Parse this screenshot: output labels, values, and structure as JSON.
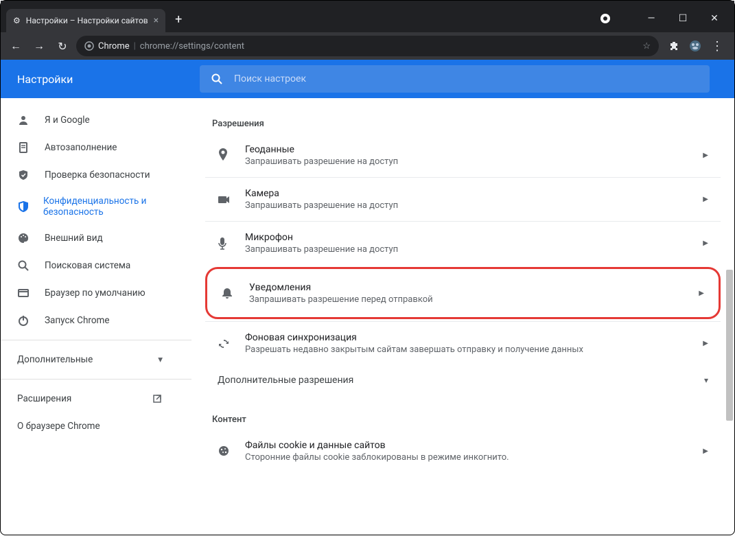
{
  "window": {
    "tab_title": "Настройки – Настройки сайтов",
    "new_tab": "+",
    "minimize": "—",
    "maximize": "☐",
    "close": "✕"
  },
  "toolbar": {
    "back": "←",
    "forward": "→",
    "reload": "↻",
    "chrome_label": "Chrome",
    "url": "chrome://settings/content",
    "star": "☆"
  },
  "header": {
    "title": "Настройки",
    "search_placeholder": "Поиск настроек"
  },
  "sidebar": {
    "items": [
      {
        "icon": "person",
        "label": "Я и Google"
      },
      {
        "icon": "autofill",
        "label": "Автозаполнение"
      },
      {
        "icon": "shield",
        "label": "Проверка безопасности"
      },
      {
        "icon": "privacy",
        "label": "Конфиденциальность и безопасность"
      },
      {
        "icon": "palette",
        "label": "Внешний вид"
      },
      {
        "icon": "search",
        "label": "Поисковая система"
      },
      {
        "icon": "browser",
        "label": "Браузер по умолчанию"
      },
      {
        "icon": "power",
        "label": "Запуск Chrome"
      }
    ],
    "more": "Дополнительные",
    "extensions": "Расширения",
    "about": "О браузере Chrome"
  },
  "main": {
    "perm_title": "Разрешения",
    "rows": [
      {
        "icon": "location",
        "title": "Геоданные",
        "sub": "Запрашивать разрешение на доступ"
      },
      {
        "icon": "camera",
        "title": "Камера",
        "sub": "Запрашивать разрешение на доступ"
      },
      {
        "icon": "mic",
        "title": "Микрофон",
        "sub": "Запрашивать разрешение на доступ"
      },
      {
        "icon": "bell",
        "title": "Уведомления",
        "sub": "Запрашивать разрешение перед отправкой"
      },
      {
        "icon": "sync",
        "title": "Фоновая синхронизация",
        "sub": "Разрешать недавно закрытым сайтам завершать отправку и получение данных"
      }
    ],
    "more_perm": "Дополнительные разрешения",
    "content_title": "Контент",
    "content_rows": [
      {
        "icon": "cookie",
        "title": "Файлы cookie и данные сайтов",
        "sub": "Сторонние файлы cookie заблокированы в режиме инкогнито."
      }
    ]
  }
}
